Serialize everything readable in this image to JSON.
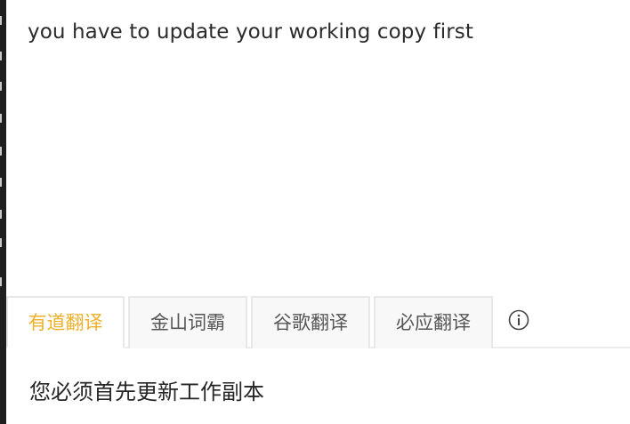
{
  "source": {
    "text": "you have to update your working copy first"
  },
  "tabs": [
    {
      "label": "有道翻译",
      "active": true
    },
    {
      "label": "金山词霸",
      "active": false
    },
    {
      "label": "谷歌翻译",
      "active": false
    },
    {
      "label": "必应翻译",
      "active": false
    }
  ],
  "info_icon": "info-circle-icon",
  "result": {
    "text": "您必须首先更新工作副本"
  },
  "colors": {
    "active_tab": "#efb02a",
    "inactive_tab_text": "#555555",
    "tab_background": "#f8f8f8",
    "left_strip": "#1f1f1f"
  }
}
